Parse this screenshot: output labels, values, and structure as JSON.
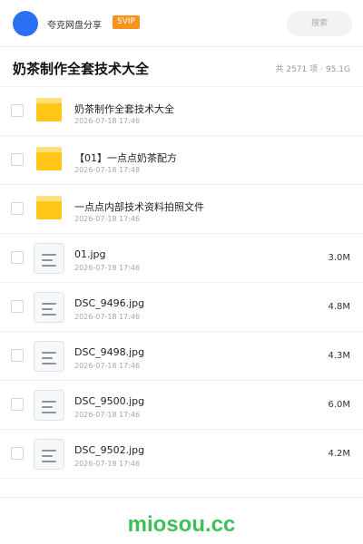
{
  "header": {
    "share_name": "夸克网盘分享",
    "svip_badge": "SVIP",
    "search_placeholder": "搜索",
    "avatar_color": "#2b6ff5"
  },
  "folder": {
    "title": "奶茶制作全套技术大全",
    "count_text": "共 2571 项",
    "separator": "·",
    "total_size": "95.1G"
  },
  "files": [
    {
      "icon": "folder-icon",
      "name": "奶茶制作全套技术大全",
      "date": "2026-07-18 17:46",
      "size": ""
    },
    {
      "icon": "folder-icon",
      "name": "【01】一点点奶茶配方",
      "date": "2026-07-18 17:48",
      "size": ""
    },
    {
      "icon": "folder-icon",
      "name": "一点点内部技术资料拍照文件",
      "date": "2026-07-18 17:46",
      "size": ""
    },
    {
      "icon": "document-icon",
      "name": "01.jpg",
      "date": "2026-07-18 17:46",
      "size": "3.0M"
    },
    {
      "icon": "document-icon",
      "name": "DSC_9496.jpg",
      "date": "2026-07-18 17:46",
      "size": "4.8M"
    },
    {
      "icon": "document-icon",
      "name": "DSC_9498.jpg",
      "date": "2026-07-18 17:46",
      "size": "4.3M"
    },
    {
      "icon": "document-icon",
      "name": "DSC_9500.jpg",
      "date": "2026-07-18 17:46",
      "size": "6.0M"
    },
    {
      "icon": "document-icon",
      "name": "DSC_9502.jpg",
      "date": "2026-07-18 17:46",
      "size": "4.2M"
    }
  ],
  "footer": {
    "watermark": "miosou.cc"
  },
  "colors": {
    "svip": "#f7941d",
    "folder": "#ffc517",
    "watermark": "#3cc05a"
  }
}
